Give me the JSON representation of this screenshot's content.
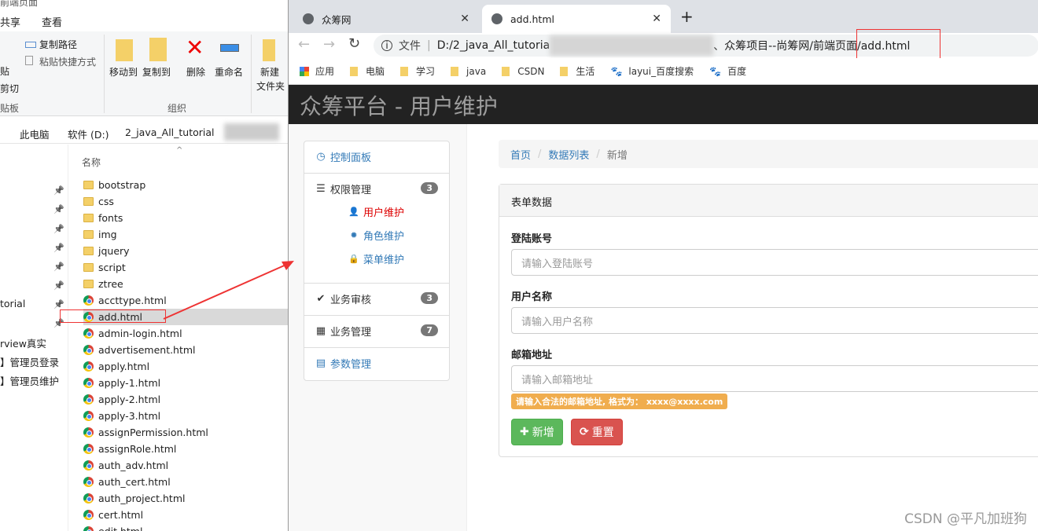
{
  "explorer": {
    "title_partial": "前端页面",
    "menu": [
      "共享",
      "查看"
    ],
    "ribbon": {
      "paste": "贴",
      "cut": "剪切",
      "copy_path": "复制路径",
      "paste_shortcut": "粘贴快捷方式",
      "clipboard_group": "贴板",
      "move_to": "移动到",
      "copy_to": "复制到",
      "delete": "删除",
      "rename": "重命名",
      "organize_group": "组织",
      "new_folder_1": "新建",
      "new_folder_2": "文件夹"
    },
    "breadcrumb": [
      "此电脑",
      "软件 (D:)",
      "2_java_All_tutorial"
    ],
    "column_name": "名称",
    "nav": [
      "torial",
      "rview真实",
      "】管理员登录",
      "】管理员维护"
    ],
    "files": [
      {
        "name": "bootstrap",
        "type": "folder"
      },
      {
        "name": "css",
        "type": "folder"
      },
      {
        "name": "fonts",
        "type": "folder"
      },
      {
        "name": "img",
        "type": "folder"
      },
      {
        "name": "jquery",
        "type": "folder"
      },
      {
        "name": "script",
        "type": "folder"
      },
      {
        "name": "ztree",
        "type": "folder"
      },
      {
        "name": "accttype.html",
        "type": "html"
      },
      {
        "name": "add.html",
        "type": "html",
        "selected": true
      },
      {
        "name": "admin-login.html",
        "type": "html"
      },
      {
        "name": "advertisement.html",
        "type": "html"
      },
      {
        "name": "apply.html",
        "type": "html"
      },
      {
        "name": "apply-1.html",
        "type": "html"
      },
      {
        "name": "apply-2.html",
        "type": "html"
      },
      {
        "name": "apply-3.html",
        "type": "html"
      },
      {
        "name": "assignPermission.html",
        "type": "html"
      },
      {
        "name": "assignRole.html",
        "type": "html"
      },
      {
        "name": "auth_adv.html",
        "type": "html"
      },
      {
        "name": "auth_cert.html",
        "type": "html"
      },
      {
        "name": "auth_project.html",
        "type": "html"
      },
      {
        "name": "cert.html",
        "type": "html"
      },
      {
        "name": "edit.html",
        "type": "html"
      }
    ]
  },
  "browser": {
    "tabs": [
      {
        "label": "众筹网"
      },
      {
        "label": "add.html",
        "active": true
      }
    ],
    "url_prefix": "文件",
    "url_start": "D:/2_java_All_tutoria",
    "url_end": "、众筹项目--尚筹网/前端页面/add.html",
    "bookmarks": [
      {
        "label": "应用",
        "icon": "apps-icon"
      },
      {
        "label": "电脑",
        "icon": "folder-icon"
      },
      {
        "label": "学习",
        "icon": "folder-icon"
      },
      {
        "label": "java",
        "icon": "folder-icon"
      },
      {
        "label": "CSDN",
        "icon": "folder-icon"
      },
      {
        "label": "生活",
        "icon": "folder-icon"
      },
      {
        "label": "layui_百度搜索",
        "icon": "baidu-icon"
      },
      {
        "label": "百度",
        "icon": "baidu-icon"
      }
    ]
  },
  "page": {
    "brand": "众筹平台 - 用户维护",
    "sidebar": [
      {
        "label": "控制面板"
      },
      {
        "label": "权限管理",
        "badge": "3",
        "children": [
          "用户维护",
          "角色维护",
          "菜单维护"
        ]
      },
      {
        "label": "业务审核",
        "badge": "3"
      },
      {
        "label": "业务管理",
        "badge": "7"
      },
      {
        "label": "参数管理"
      }
    ],
    "breadcrumb": [
      "首页",
      "数据列表",
      "新增"
    ],
    "panel_title": "表单数据",
    "fields": [
      {
        "label": "登陆账号",
        "placeholder": "请输入登陆账号"
      },
      {
        "label": "用户名称",
        "placeholder": "请输入用户名称"
      },
      {
        "label": "邮箱地址",
        "placeholder": "请输入邮箱地址"
      }
    ],
    "email_hint": "请输入合法的邮箱地址, 格式为： xxxx@xxxx.com",
    "add_button": "新增",
    "reset_button": "重置",
    "colors": {
      "success": "#5cb85c",
      "danger": "#d9534f",
      "warning": "#f0ad4e",
      "navbar": "#222222"
    }
  },
  "watermark": "CSDN @平凡加班狗"
}
